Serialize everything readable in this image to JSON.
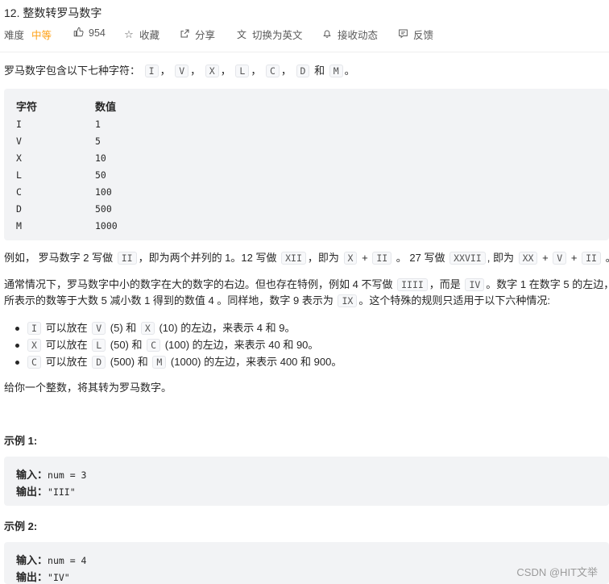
{
  "problem": {
    "title": "12. 整数转罗马数字",
    "difficulty_label": "难度",
    "difficulty": "中等",
    "likes": "954",
    "collect": "收藏",
    "share": "分享",
    "switch_lang": "切换为英文",
    "notify": "接收动态",
    "feedback": "反馈"
  },
  "icons": {
    "like": "thumbs-up-icon",
    "collect": "star-icon",
    "share": "share-icon",
    "translate": "translate-icon",
    "bell": "bell-icon",
    "feedback": "feedback-icon"
  },
  "colors": {
    "difficulty": "#ffa116",
    "code_bg": "#f2f3f5"
  },
  "intro": {
    "text": "罗马数字包含以下七种字符：",
    "chars": [
      "I",
      "V",
      "X",
      "L",
      "C",
      "D",
      "M"
    ],
    "sep": "，",
    "and": "和",
    "end": "。"
  },
  "table": {
    "header": [
      "字符",
      "数值"
    ],
    "rows": [
      [
        "I",
        "1"
      ],
      [
        "V",
        "5"
      ],
      [
        "X",
        "10"
      ],
      [
        "L",
        "50"
      ],
      [
        "C",
        "100"
      ],
      [
        "D",
        "500"
      ],
      [
        "M",
        "1000"
      ]
    ]
  },
  "example_line": {
    "a": "例如， 罗马数字 2 写做",
    "c1": "II",
    "b": "，即为两个并列的 1。12 写做",
    "c2": "XII",
    "d": "，即为",
    "c3": "X",
    "plus": "+",
    "c4": "II",
    "e": "。 27 写做",
    "c5": "XXVII",
    "f": ", 即为",
    "c6": "XX",
    "c7": "V",
    "c8": "II",
    "g": "。"
  },
  "special": {
    "l1_a": "通常情况下，罗马数字中小的数字在大的数字的右边。但也存在特例，例如 4 不写做",
    "l1_c1": "IIII",
    "l1_b": "，而是",
    "l1_c2": "IV",
    "l1_c": "。数字 1 在数字 5 的左边，",
    "l2_a": "所表示的数等于大数 5 减小数 1 得到的数值 4 。同样地，数字 9 表示为",
    "l2_c1": "IX",
    "l2_b": "。这个特殊的规则只适用于以下六种情况:"
  },
  "rules": [
    {
      "c1": "I",
      "t1": "可以放在",
      "c2": "V",
      "t2": "(5) 和",
      "c3": "X",
      "t3": "(10) 的左边，来表示 4 和 9。"
    },
    {
      "c1": "X",
      "t1": "可以放在",
      "c2": "L",
      "t2": "(50) 和",
      "c3": "C",
      "t3": "(100) 的左边，来表示 40 和 90。"
    },
    {
      "c1": "C",
      "t1": "可以放在",
      "c2": "D",
      "t2": "(500) 和",
      "c3": "M",
      "t3": "(1000) 的左边，来表示 400 和 900。"
    }
  ],
  "task": "给你一个整数，将其转为罗马数字。",
  "examples": [
    {
      "title": "示例 1:",
      "in_label": "输入：",
      "in_value": "num = 3",
      "out_label": "输出：",
      "out_value": "\"III\""
    },
    {
      "title": "示例 2:",
      "in_label": "输入：",
      "in_value": "num = 4",
      "out_label": "输出：",
      "out_value": "\"IV\""
    }
  ],
  "watermark": "CSDN @HIT文举"
}
